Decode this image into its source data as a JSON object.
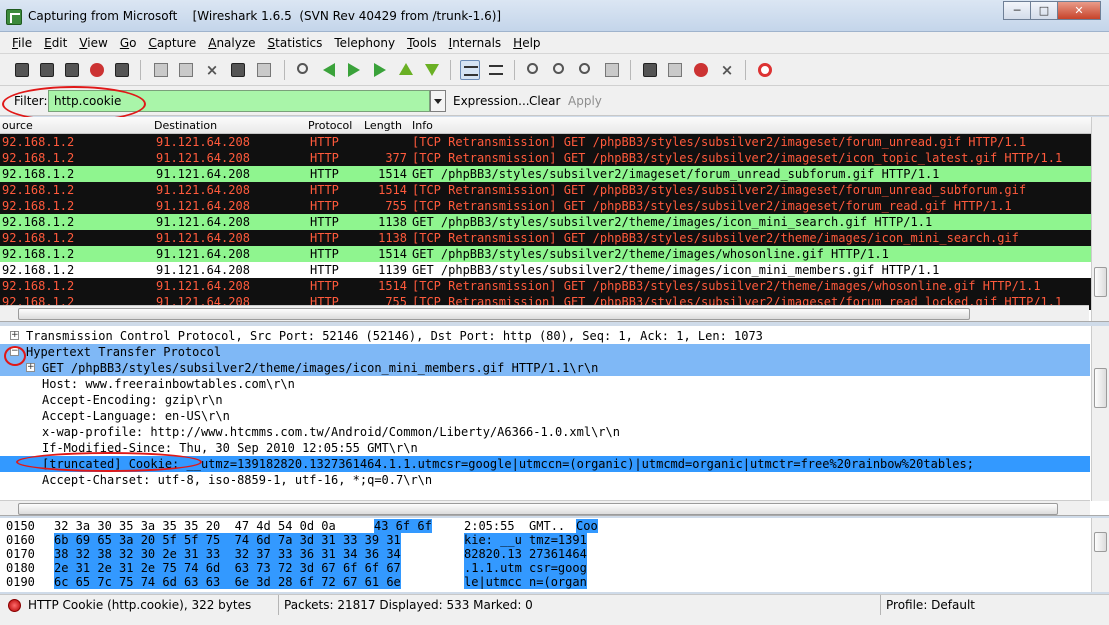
{
  "window": {
    "title": "Capturing from Microsoft",
    "subtitle": "[Wireshark 1.6.5  (SVN Rev 40429 from /trunk-1.6)]",
    "minimize": "─",
    "maximize": "□",
    "close": "✕"
  },
  "menu": [
    {
      "u": "F",
      "rest": "ile"
    },
    {
      "u": "E",
      "rest": "dit"
    },
    {
      "u": "V",
      "rest": "iew"
    },
    {
      "u": "G",
      "rest": "o"
    },
    {
      "u": "C",
      "rest": "apture"
    },
    {
      "u": "A",
      "rest": "nalyze"
    },
    {
      "u": "S",
      "rest": "tatistics"
    },
    {
      "u": "",
      "rest": "Telephony"
    },
    {
      "u": "T",
      "rest": "ools"
    },
    {
      "u": "I",
      "rest": "nternals"
    },
    {
      "u": "H",
      "rest": "elp"
    }
  ],
  "filter": {
    "label": "Filter:",
    "value": "http.cookie",
    "expression": "Expression...",
    "clear": "Clear",
    "apply": "Apply"
  },
  "packet_list": {
    "columns": [
      "ource",
      "Destination",
      "Protocol",
      "Length",
      "Info"
    ],
    "rows": [
      {
        "style": "rt",
        "src": "92.168.1.2",
        "dst": "91.121.64.208",
        "proto": "HTTP",
        "len": "",
        "info": "[TCP Retransmission] GET /phpBB3/styles/subsilver2/imageset/forum_unread.gif HTTP/1.1"
      },
      {
        "style": "rt",
        "src": "92.168.1.2",
        "dst": "91.121.64.208",
        "proto": "HTTP",
        "len": "377",
        "info": "[TCP Retransmission] GET /phpBB3/styles/subsilver2/imageset/icon_topic_latest.gif HTTP/1.1"
      },
      {
        "style": "green",
        "src": "92.168.1.2",
        "dst": "91.121.64.208",
        "proto": "HTTP",
        "len": "1514",
        "info": "GET /phpBB3/styles/subsilver2/imageset/forum_unread_subforum.gif HTTP/1.1"
      },
      {
        "style": "rt",
        "src": "92.168.1.2",
        "dst": "91.121.64.208",
        "proto": "HTTP",
        "len": "1514",
        "info": "[TCP Retransmission] GET /phpBB3/styles/subsilver2/imageset/forum_unread_subforum.gif"
      },
      {
        "style": "rt",
        "src": "92.168.1.2",
        "dst": "91.121.64.208",
        "proto": "HTTP",
        "len": "755",
        "info": "[TCP Retransmission] GET /phpBB3/styles/subsilver2/imageset/forum_read.gif HTTP/1.1"
      },
      {
        "style": "green",
        "src": "92.168.1.2",
        "dst": "91.121.64.208",
        "proto": "HTTP",
        "len": "1138",
        "info": "GET /phpBB3/styles/subsilver2/theme/images/icon_mini_search.gif HTTP/1.1"
      },
      {
        "style": "rt",
        "src": "92.168.1.2",
        "dst": "91.121.64.208",
        "proto": "HTTP",
        "len": "1138",
        "info": "[TCP Retransmission] GET /phpBB3/styles/subsilver2/theme/images/icon_mini_search.gif"
      },
      {
        "style": "green",
        "src": "92.168.1.2",
        "dst": "91.121.64.208",
        "proto": "HTTP",
        "len": "1514",
        "info": "GET /phpBB3/styles/subsilver2/theme/images/whosonline.gif HTTP/1.1"
      },
      {
        "style": "white",
        "src": "92.168.1.2",
        "dst": "91.121.64.208",
        "proto": "HTTP",
        "len": "1139",
        "info": "GET /phpBB3/styles/subsilver2/theme/images/icon_mini_members.gif HTTP/1.1"
      },
      {
        "style": "rt",
        "src": "92.168.1.2",
        "dst": "91.121.64.208",
        "proto": "HTTP",
        "len": "1514",
        "info": "[TCP Retransmission] GET /phpBB3/styles/subsilver2/theme/images/whosonline.gif HTTP/1.1"
      },
      {
        "style": "rt",
        "src": "92.168.1.2",
        "dst": "91.121.64.208",
        "proto": "HTTP",
        "len": "755",
        "info": "[TCP Retransmission] GET /phpBB3/styles/subsilver2/imageset/forum_read_locked.gif HTTP/1.1"
      }
    ]
  },
  "details": {
    "rows": [
      {
        "indent": 0,
        "expander": "+",
        "text": "Transmission Control Protocol, Src Port: 52146 (52146), Dst Port: http (80), Seq: 1, Ack: 1, Len: 1073",
        "sel": ""
      },
      {
        "indent": 0,
        "expander": "−",
        "text": "Hypertext Transfer Protocol",
        "sel": "sel-light"
      },
      {
        "indent": 1,
        "expander": "+",
        "text": "GET /phpBB3/styles/subsilver2/theme/images/icon_mini_members.gif HTTP/1.1\\r\\n",
        "sel": "sel-light"
      },
      {
        "indent": 1,
        "expander": "",
        "text": "Host: www.freerainbowtables.com\\r\\n",
        "sel": ""
      },
      {
        "indent": 1,
        "expander": "",
        "text": "Accept-Encoding: gzip\\r\\n",
        "sel": ""
      },
      {
        "indent": 1,
        "expander": "",
        "text": "Accept-Language: en-US\\r\\n",
        "sel": ""
      },
      {
        "indent": 1,
        "expander": "",
        "text": "x-wap-profile: http://www.htcmms.com.tw/Android/Common/Liberty/A6366-1.0.xml\\r\\n",
        "sel": ""
      },
      {
        "indent": 1,
        "expander": "",
        "text": "If-Modified-Since: Thu, 30 Sep 2010 12:05:55 GMT\\r\\n",
        "sel": ""
      },
      {
        "indent": 1,
        "expander": "",
        "text": "[truncated] Cookie: __utmz=139182820.1327361464.1.1.utmcsr=google|utmccn=(organic)|utmcmd=organic|utmctr=free%20rainbow%20tables;",
        "sel": "sel"
      },
      {
        "indent": 1,
        "expander": "",
        "text": "Accept-Charset: utf-8, iso-8859-1, utf-16, *;q=0.7\\r\\n",
        "sel": ""
      }
    ]
  },
  "bytes": {
    "rows": [
      {
        "offset": "0150",
        "hex_plain": "32 3a 30 35 3a 35 35 20  47 4d 54 0d 0a ",
        "hex_hl": "43 6f 6f",
        "ascii_plain": "2:05:55  GMT..",
        "ascii_hl": "Coo"
      },
      {
        "offset": "0160",
        "hex_plain": "",
        "hex_hl": "6b 69 65 3a 20 5f 5f 75  74 6d 7a 3d 31 33 39 31",
        "ascii_plain": "",
        "ascii_hl": "kie: __u tmz=1391"
      },
      {
        "offset": "0170",
        "hex_plain": "",
        "hex_hl": "38 32 38 32 30 2e 31 33  32 37 33 36 31 34 36 34",
        "ascii_plain": "",
        "ascii_hl": "82820.13 27361464"
      },
      {
        "offset": "0180",
        "hex_plain": "",
        "hex_hl": "2e 31 2e 31 2e 75 74 6d  63 73 72 3d 67 6f 6f 67",
        "ascii_plain": "",
        "ascii_hl": ".1.1.utm csr=goog"
      },
      {
        "offset": "0190",
        "hex_plain": "",
        "hex_hl": "6c 65 7c 75 74 6d 63 63  6e 3d 28 6f 72 67 61 6e",
        "ascii_plain": "",
        "ascii_hl": "le|utmcc n=(organ"
      }
    ]
  },
  "status": {
    "field": "HTTP Cookie (http.cookie), 322 bytes",
    "packets": "Packets: 21817 Displayed: 533 Marked: 0",
    "profile": "Profile: Default"
  },
  "colors": {
    "retransmission_bg": "#101010",
    "retransmission_fg": "#ff5a3c",
    "http_green": "#8ff58f",
    "selection": "#3399ff",
    "filter_valid": "#a9f5a9",
    "annotation": "#e01818"
  },
  "icons": [
    "interfaces-icon",
    "options-icon",
    "start-icon",
    "stop-icon",
    "restart-icon",
    "open-icon",
    "save-icon",
    "close-file-icon",
    "reload-icon",
    "print-icon",
    "find-icon",
    "back-icon",
    "forward-icon",
    "goto-icon",
    "first-icon",
    "last-icon",
    "colorize-icon",
    "autoscroll-icon",
    "zoom-in-icon",
    "zoom-out-icon",
    "zoom-normal-icon",
    "resize-columns-icon",
    "capture-filter-icon",
    "display-filter-icon",
    "coloring-rules-icon",
    "preferences-icon",
    "help-icon"
  ]
}
